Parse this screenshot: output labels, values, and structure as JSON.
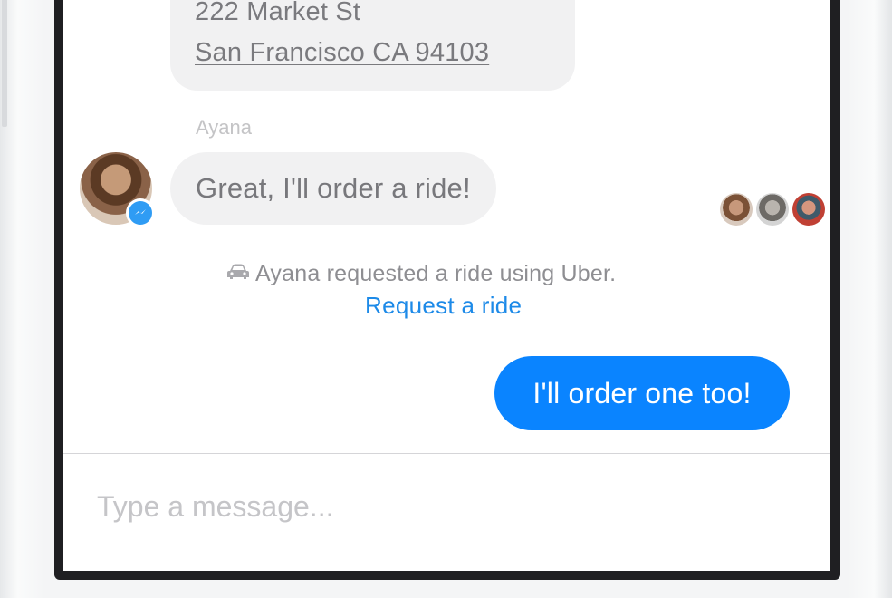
{
  "conversation": {
    "address_lines": [
      "222 Market St",
      "San Francisco CA 94103"
    ],
    "sender_name": "Ayana",
    "incoming_message": "Great, I'll order a ride!",
    "ride_notice": "Ayana requested a ride using Uber.",
    "ride_link": "Request a ride",
    "outgoing_message": "I'll order one too!"
  },
  "composer": {
    "placeholder": "Type a message..."
  },
  "icons": {
    "car": "car-icon",
    "messenger_badge": "messenger-icon"
  },
  "colors": {
    "outgoing_bubble": "#0a84ff",
    "incoming_bubble": "#f1f1f2",
    "link": "#1d8ae8",
    "messenger_badge": "#2f9cf4"
  }
}
